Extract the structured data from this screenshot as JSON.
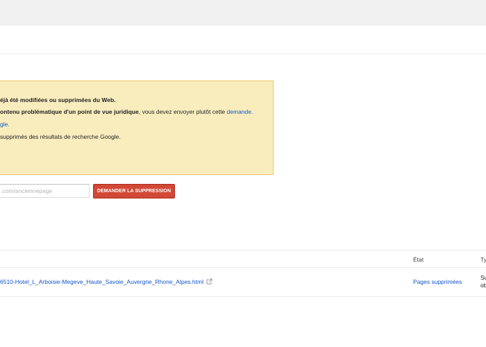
{
  "notice": {
    "line1": "éjà été modifiées ou supprimées du Web.",
    "line2_bold": "ontenu problématique d'un point de vue juridique",
    "line2_text": ", vous devez envoyer plutôt cette ",
    "line2_link": "demande.",
    "line3_link": "gle.",
    "line4": "supprimés des résultats de recherche Google."
  },
  "form": {
    "url_placeholder": ".com/anciennepage",
    "submit_label": "DEMANDER LA SUPPRESSION"
  },
  "table": {
    "headers": {
      "state": "État",
      "type": "Ty"
    },
    "rows": [
      {
        "url": "6510-Hotel_L_Arboisie-Megeve_Haute_Savoie_Auvergne_Rhone_Alpes.html",
        "state": "Pages supprimées",
        "type_line1": "Su",
        "type_line2": "ob"
      }
    ]
  },
  "colors": {
    "notice_bg": "#f9edbe",
    "link": "#1155cc",
    "primary_button": "#d14836"
  }
}
